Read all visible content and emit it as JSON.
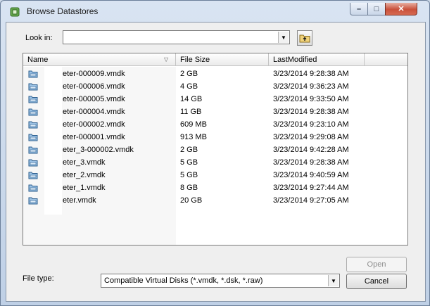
{
  "window": {
    "title": "Browse Datastores"
  },
  "look_in": {
    "label": "Look in:",
    "value": ""
  },
  "columns": {
    "name": "Name",
    "size": "File Size",
    "modified": "LastModified"
  },
  "files": [
    {
      "name": "eter-000009.vmdk",
      "size": "2 GB",
      "modified": "3/23/2014 9:28:38 AM"
    },
    {
      "name": "eter-000006.vmdk",
      "size": "4 GB",
      "modified": "3/23/2014 9:36:23 AM"
    },
    {
      "name": "eter-000005.vmdk",
      "size": "14 GB",
      "modified": "3/23/2014 9:33:50 AM"
    },
    {
      "name": "eter-000004.vmdk",
      "size": "11 GB",
      "modified": "3/23/2014 9:28:38 AM"
    },
    {
      "name": "eter-000002.vmdk",
      "size": "609 MB",
      "modified": "3/23/2014 9:23:10 AM"
    },
    {
      "name": "eter-000001.vmdk",
      "size": "913 MB",
      "modified": "3/23/2014 9:29:08 AM"
    },
    {
      "name": "eter_3-000002.vmdk",
      "size": "2 GB",
      "modified": "3/23/2014 9:42:28 AM"
    },
    {
      "name": "eter_3.vmdk",
      "size": "5 GB",
      "modified": "3/23/2014 9:28:38 AM"
    },
    {
      "name": "eter_2.vmdk",
      "size": "5 GB",
      "modified": "3/23/2014 9:40:59 AM"
    },
    {
      "name": "eter_1.vmdk",
      "size": "8 GB",
      "modified": "3/23/2014 9:27:44 AM"
    },
    {
      "name": "eter.vmdk",
      "size": "20 GB",
      "modified": "3/23/2014 9:27:05 AM"
    }
  ],
  "file_type": {
    "label": "File type:",
    "value": "Compatible Virtual Disks (*.vmdk, *.dsk, *.raw)"
  },
  "buttons": {
    "open": "Open",
    "cancel": "Cancel"
  },
  "icons": {
    "app": "datastore-app-icon",
    "up_folder": "up-folder-icon",
    "file": "virtual-disk-icon",
    "dropdown": "chevron-down-icon"
  }
}
